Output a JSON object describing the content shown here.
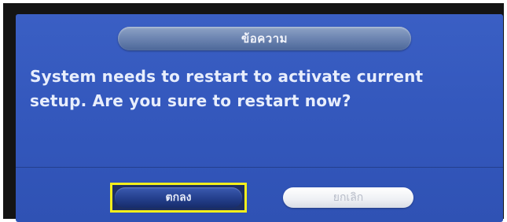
{
  "dialog": {
    "title": "ข้อความ",
    "message_line1": "System needs to restart to activate current",
    "message_line2": "setup. Are you sure to restart now?"
  },
  "buttons": {
    "ok_label": "ตกลง",
    "cancel_label": "ยกเลิก"
  },
  "colors": {
    "dialog_background": "#3458bd",
    "highlight": "#f4ef1c",
    "text": "#e8eefc"
  }
}
